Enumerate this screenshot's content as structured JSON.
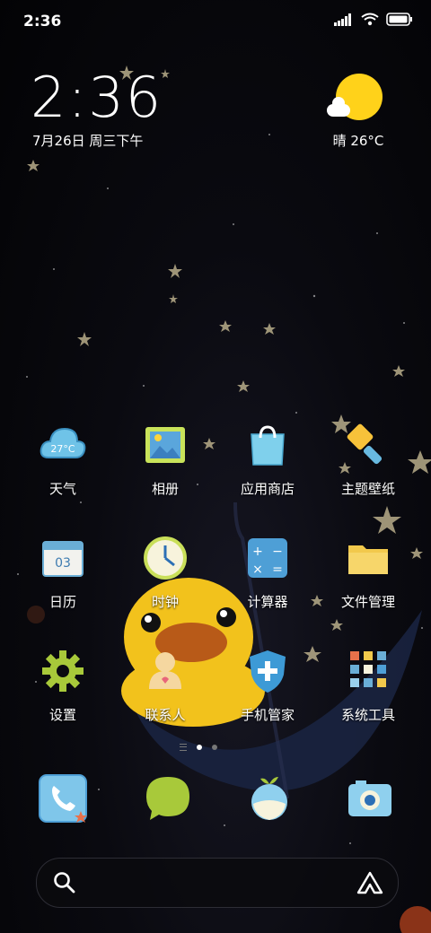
{
  "status_bar": {
    "time": "2:36"
  },
  "clock_widget": {
    "time": "2:36",
    "date": "7月26日 周三下午"
  },
  "weather_widget": {
    "text": "晴 26°C",
    "icon": "sunny-partly-cloudy-icon"
  },
  "apps": [
    {
      "label": "天气",
      "icon": "weather-cloud-icon",
      "badge": "27°C"
    },
    {
      "label": "相册",
      "icon": "gallery-icon"
    },
    {
      "label": "应用商店",
      "icon": "app-store-bag-icon"
    },
    {
      "label": "主题壁纸",
      "icon": "theme-brush-icon"
    },
    {
      "label": "日历",
      "icon": "calendar-icon",
      "badge": "03"
    },
    {
      "label": "时钟",
      "icon": "clock-icon"
    },
    {
      "label": "计算器",
      "icon": "calculator-icon"
    },
    {
      "label": "文件管理",
      "icon": "folder-icon"
    },
    {
      "label": "设置",
      "icon": "gear-icon"
    },
    {
      "label": "联系人",
      "icon": "contacts-icon"
    },
    {
      "label": "手机管家",
      "icon": "shield-plus-icon"
    },
    {
      "label": "系统工具",
      "icon": "tools-folder-icon"
    }
  ],
  "dock": [
    {
      "icon": "phone-icon"
    },
    {
      "icon": "messages-icon"
    },
    {
      "icon": "browser-globe-icon"
    },
    {
      "icon": "camera-icon"
    }
  ],
  "page_indicator": {
    "pages": 2,
    "current": 1
  },
  "search_bar": {
    "left_icon": "search-icon",
    "right_icon": "assistant-icon"
  },
  "colors": {
    "sun": "#ffd21a",
    "text": "#ffffff"
  }
}
